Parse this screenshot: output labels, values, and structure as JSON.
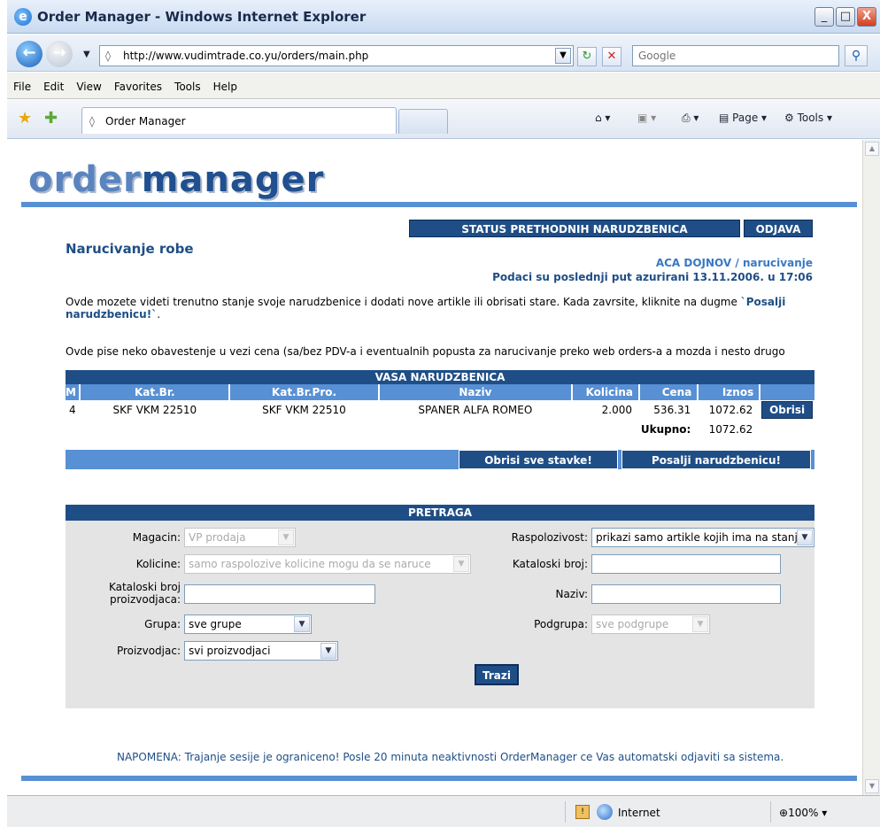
{
  "window": {
    "title": "Order Manager - Windows Internet Explorer",
    "minimize": "_",
    "maximize": "□",
    "close": "X"
  },
  "addressbar": {
    "url": "http://www.vudimtrade.co.yu/orders/main.php",
    "search_placeholder": "Google"
  },
  "menu": [
    "File",
    "Edit",
    "View",
    "Favorites",
    "Tools",
    "Help"
  ],
  "favbar": {
    "tab_label": "Order Manager",
    "page_label": "Page",
    "tools_label": "Tools"
  },
  "header": {
    "logo_first": "order",
    "logo_second": "manager",
    "status_button": "STATUS PRETHODNIH NARUDZBENICA",
    "logout_button": "ODJAVA",
    "page_title": "Narucivanje robe",
    "user_line": "ACA DOJNOV / narucivanje",
    "updated_line": "Podaci su poslednji put azurirani 13.11.2006. u 17:06"
  },
  "intro": {
    "text": "Ovde mozete videti trenutno stanje svoje narudzbenice i dodati nove artikle ili obrisati stare. Kada zavrsite, kliknite na dugme ",
    "link": "`Posalji narudzbenicu!`",
    "end": ".",
    "notice": "Ovde pise neko obavestenje u vezi cena (sa/bez PDV-a i eventualnih popusta za narucivanje preko web orders-a a mozda i nesto drugo"
  },
  "order": {
    "caption": "VASA NARUDZBENICA",
    "columns": [
      "M",
      "Kat.Br.",
      "Kat.Br.Pro.",
      "Naziv",
      "Kolicina",
      "Cena",
      "Iznos"
    ],
    "rows": [
      {
        "m": "4",
        "kat": "SKF VKM 22510",
        "kat_pro": "SKF VKM 22510",
        "naziv": "SPANER ALFA ROMEO",
        "kolicina": "2.000",
        "cena": "536.31",
        "iznos": "1072.62",
        "action": "Obrisi"
      }
    ],
    "total_label": "Ukupno:",
    "total_value": "1072.62",
    "delete_all": "Obrisi sve stavke!",
    "send": "Posalji narudzbenicu!"
  },
  "search": {
    "caption": "PRETRAGA",
    "magacin_label": "Magacin:",
    "magacin_value": "VP prodaja",
    "kolicine_label": "Kolicine:",
    "kolicine_value": "samo raspolozive kolicine mogu da se naruce",
    "katpro_label_1": "Kataloski broj",
    "katpro_label_2": "proizvodjaca:",
    "grupa_label": "Grupa:",
    "grupa_value": "sve grupe",
    "proizvodjac_label": "Proizvodjac:",
    "proizvodjac_value": "svi proizvodjaci",
    "raspolozivost_label": "Raspolozivost:",
    "raspolozivost_value": "prikazi samo artikle kojih ima na stanju",
    "katbroj_label": "Kataloski broj:",
    "naziv_label": "Naziv:",
    "podgrupa_label": "Podgrupa:",
    "podgrupa_value": "sve podgrupe",
    "search_button": "Trazi"
  },
  "footer": {
    "napomena": "NAPOMENA: Trajanje sesije je ograniceno! Posle 20 minuta neaktivnosti OrderManager ce Vas automatski odjaviti sa sistema."
  },
  "statusbar": {
    "zone": "Internet",
    "zoom": "100%"
  },
  "colors": {
    "dark_blue": "#1f4e86",
    "mid_blue": "#5790d4",
    "panel_gray": "#e4e4e4"
  }
}
